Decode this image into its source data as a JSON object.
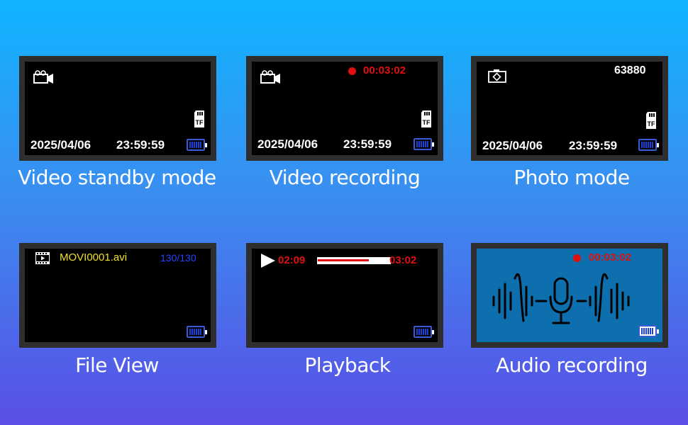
{
  "panels": [
    {
      "caption": "Video standby mode",
      "date": "2025/04/06",
      "time": "23:59:59",
      "sd_label": "TF",
      "mode_icon": "video-camera-icon",
      "battery_icon": "battery-icon"
    },
    {
      "caption": "Video recording",
      "date": "2025/04/06",
      "time": "23:59:59",
      "rec_time": "00:03:02",
      "sd_label": "TF",
      "mode_icon": "video-camera-icon",
      "battery_icon": "battery-icon"
    },
    {
      "caption": "Photo mode",
      "date": "2025/04/06",
      "time": "23:59:59",
      "photo_count": "63880",
      "sd_label": "TF",
      "mode_icon": "camera-icon",
      "battery_icon": "battery-icon"
    },
    {
      "caption": "File View",
      "file_name": "MOVI0001.avi",
      "file_index": "130/130",
      "file_name_color": "#f0e020",
      "file_index_color": "#2244ff",
      "mode_icon": "film-icon",
      "battery_icon": "battery-icon"
    },
    {
      "caption": "Playback",
      "elapsed": "02:09",
      "total": "03:02",
      "progress": 0.71,
      "mode_icon": "play-icon",
      "battery_icon": "battery-icon"
    },
    {
      "caption": "Audio recording",
      "rec_time": "00:03:02",
      "mode_icon": "microphone-icon",
      "battery_icon": "battery-icon"
    }
  ],
  "colors": {
    "record_red": "#e01010",
    "battery_blue": "#1e3fd6",
    "audio_bg": "#0e6fae"
  }
}
